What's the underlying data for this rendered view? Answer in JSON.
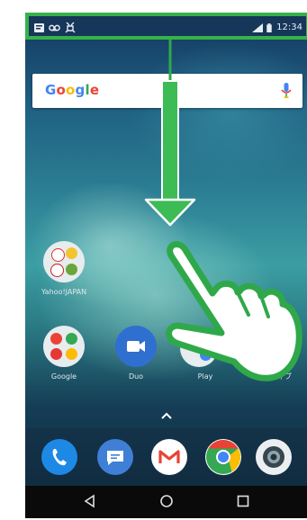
{
  "status_bar": {
    "time": "12:34",
    "left_icons": [
      "notification-icon",
      "voicemail-icon",
      "usb-debug-icon"
    ],
    "right_icons": [
      "signal-icon",
      "battery-icon"
    ],
    "highlight_color": "#35b24a"
  },
  "search": {
    "logo": [
      "G",
      "o",
      "o",
      "g",
      "l",
      "e"
    ]
  },
  "home": {
    "folder_1_label": "Yahoo!JAPAN",
    "folder_2_label": "Google",
    "duo_label": "Duo",
    "play_label": "Play",
    "extra_label": "ドライブ"
  },
  "dock": {
    "apps": [
      "phone-icon",
      "messages-icon",
      "gmail-icon",
      "chrome-icon",
      "camera-icon"
    ]
  },
  "gesture": {
    "description_icons": [
      "swipe-down-arrow-icon",
      "hand-pointer-icon"
    ],
    "color": "#35b24a"
  }
}
